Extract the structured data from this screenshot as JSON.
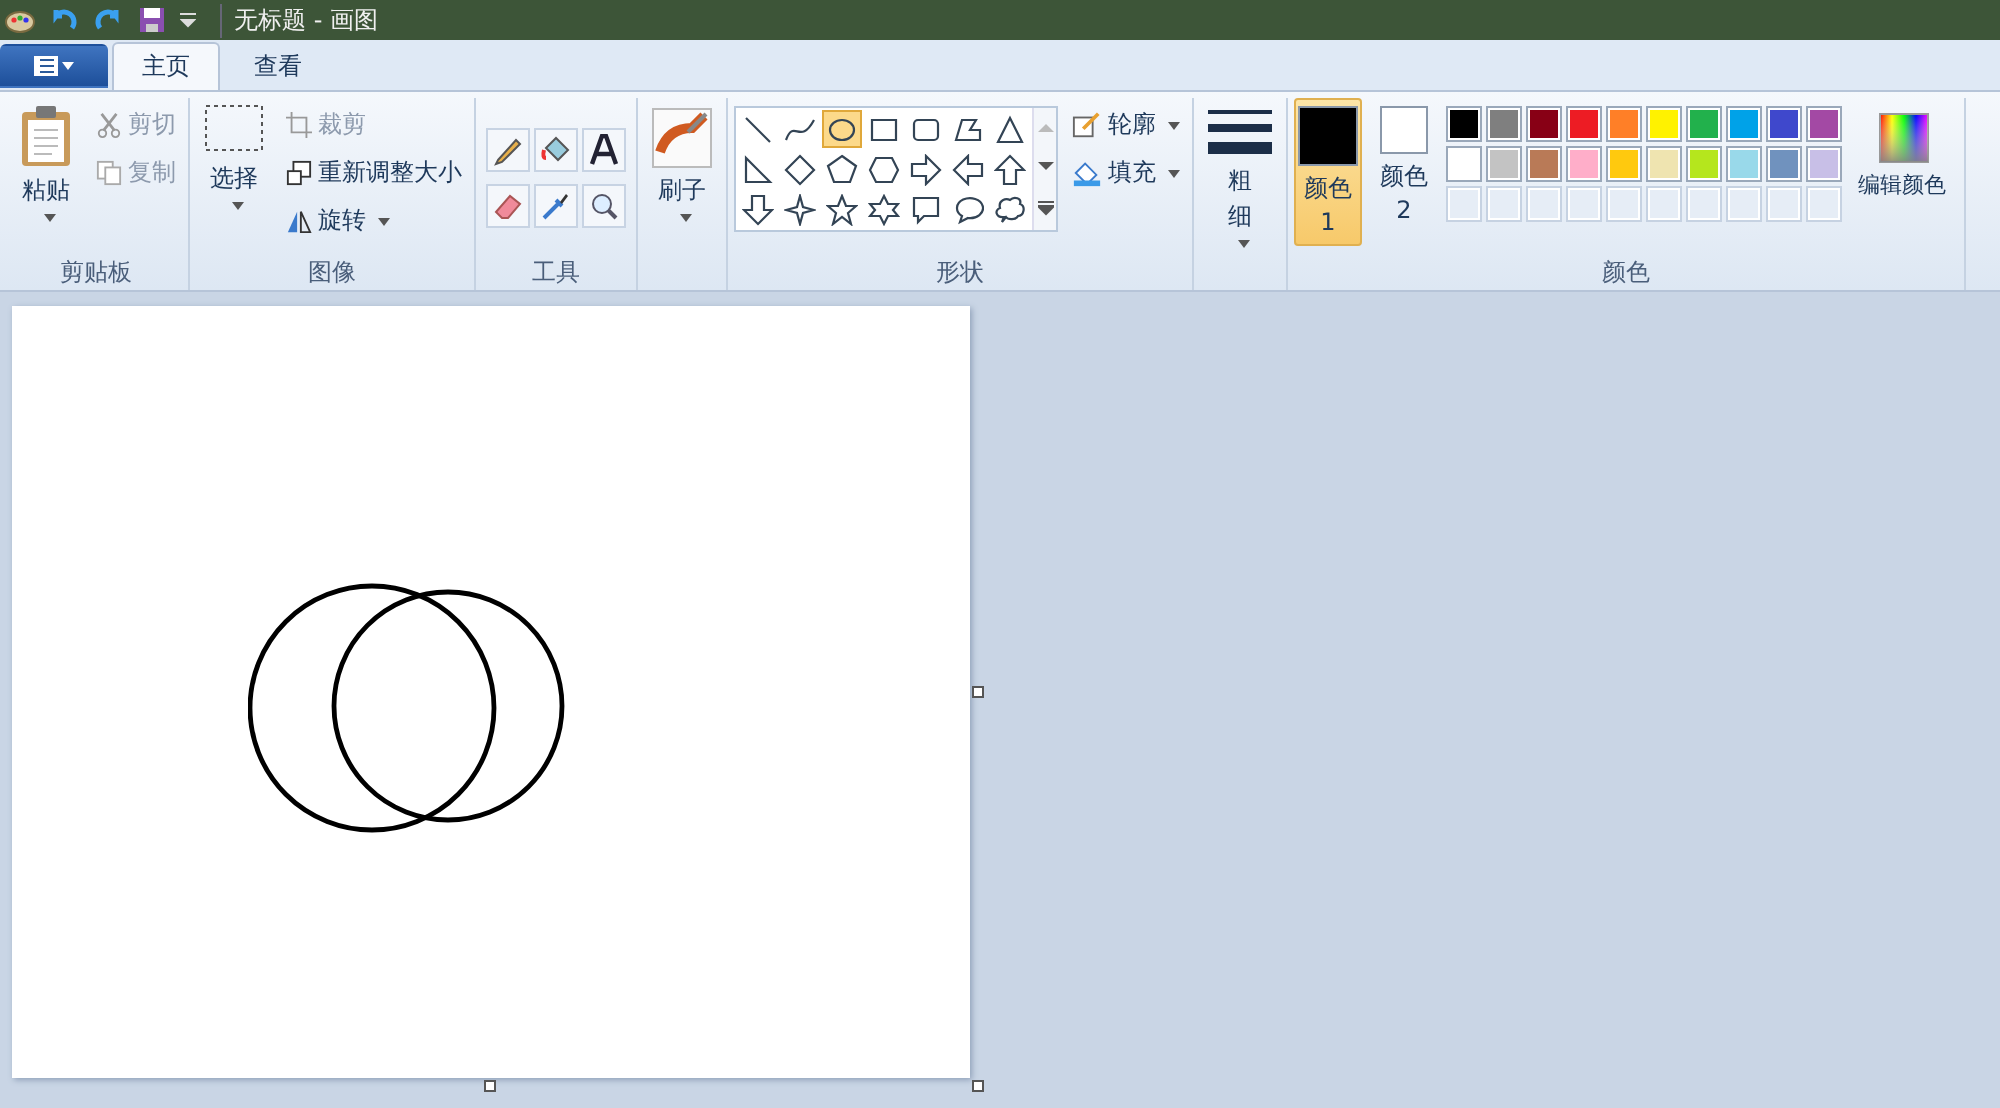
{
  "title_bar": {
    "title": "无标题 - 画图"
  },
  "tabs": [
    {
      "label": "主页",
      "selected": true
    },
    {
      "label": "查看",
      "selected": false
    }
  ],
  "clipboard": {
    "label": "剪贴板",
    "paste": "粘贴",
    "cut": {
      "label": "剪切",
      "disabled": true
    },
    "copy": {
      "label": "复制",
      "disabled": true
    }
  },
  "image": {
    "label": "图像",
    "select": "选择",
    "crop": {
      "label": "裁剪",
      "disabled": true
    },
    "resize": {
      "label": "重新调整大小",
      "disabled": false
    },
    "rotate": {
      "label": "旋转",
      "disabled": false
    }
  },
  "tools": {
    "label": "工具"
  },
  "brushes": {
    "label": "刷子"
  },
  "shapes": {
    "label": "形状",
    "outline": "轮廓",
    "fill": "填充",
    "items": [
      {
        "kind": "line",
        "selected": false
      },
      {
        "kind": "curve",
        "selected": false
      },
      {
        "kind": "oval",
        "selected": true
      },
      {
        "kind": "rectangle",
        "selected": false
      },
      {
        "kind": "rounded-rectangle",
        "selected": false
      },
      {
        "kind": "polygon",
        "selected": false
      },
      {
        "kind": "triangle",
        "selected": false
      },
      {
        "kind": "right-triangle",
        "selected": false
      },
      {
        "kind": "diamond",
        "selected": false
      },
      {
        "kind": "pentagon",
        "selected": false
      },
      {
        "kind": "hexagon",
        "selected": false
      },
      {
        "kind": "arrow-right",
        "selected": false
      },
      {
        "kind": "arrow-left",
        "selected": false
      },
      {
        "kind": "arrow-up",
        "selected": false
      },
      {
        "kind": "arrow-down",
        "selected": false
      },
      {
        "kind": "star-4",
        "selected": false
      },
      {
        "kind": "star-5",
        "selected": false
      },
      {
        "kind": "star-6",
        "selected": false
      },
      {
        "kind": "callout-rect",
        "selected": false
      },
      {
        "kind": "callout-oval",
        "selected": false
      },
      {
        "kind": "callout-cloud",
        "selected": false
      }
    ]
  },
  "size": {
    "label": "粗细"
  },
  "colors": {
    "label": "颜色",
    "color1": {
      "label": "颜色 1",
      "selected": true,
      "color": "#000000"
    },
    "color2": {
      "label": "颜色 2",
      "selected": false,
      "color": "#ffffff"
    },
    "edit": "编辑颜色",
    "palette": [
      {
        "color": "#000000"
      },
      {
        "color": "#7f7f7f"
      },
      {
        "color": "#880015"
      },
      {
        "color": "#ed1c24"
      },
      {
        "color": "#ff7f27"
      },
      {
        "color": "#fff200"
      },
      {
        "color": "#22b14c"
      },
      {
        "color": "#00a2e8"
      },
      {
        "color": "#3f48cc"
      },
      {
        "color": "#a349a4"
      },
      {
        "color": "#ffffff"
      },
      {
        "color": "#c3c3c3"
      },
      {
        "color": "#b97a57"
      },
      {
        "color": "#ffaec9"
      },
      {
        "color": "#ffc90e"
      },
      {
        "color": "#efe4b0"
      },
      {
        "color": "#b5e61d"
      },
      {
        "color": "#99d9ea"
      },
      {
        "color": "#7092be"
      },
      {
        "color": "#c8bfe7"
      }
    ]
  }
}
